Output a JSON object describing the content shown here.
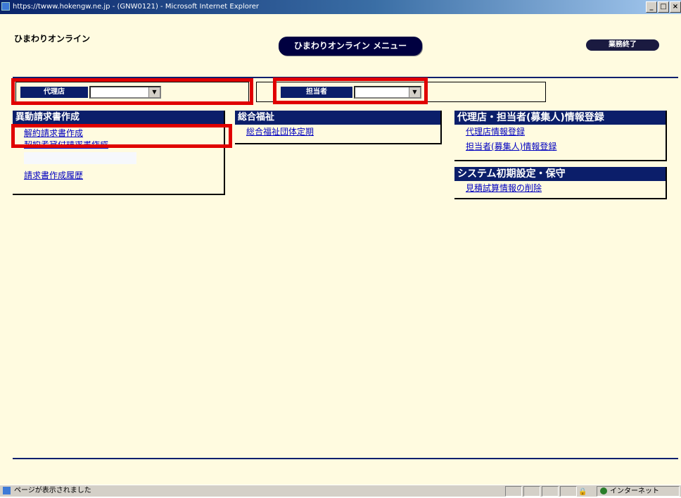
{
  "window": {
    "title": "https://twww.hokengw.ne.jp - (GNW0121) - Microsoft Internet Explorer",
    "btn_min": "_",
    "btn_max": "□",
    "btn_close": "×"
  },
  "header": {
    "app_name": "ひまわりオンライン",
    "menu_title": "ひまわりオンライン メニュー",
    "end_button": "業務終了"
  },
  "selectors": {
    "agency_label": "代理店",
    "agency_value": "",
    "staff_label": "担当者",
    "staff_value": ""
  },
  "panels": {
    "billing": {
      "title": "異動請求書作成",
      "items": [
        "解約請求書作成",
        "契約者貸付請求書作成",
        "請求書作成履歴"
      ]
    },
    "welfare": {
      "title": "総合福祉",
      "items": [
        "総合福祉団体定期"
      ]
    },
    "registration": {
      "title": "代理店・担当者(募集人)情報登録",
      "items": [
        "代理店情報登録",
        "担当者(募集人)情報登録"
      ]
    },
    "system": {
      "title": "システム初期設定・保守",
      "items": [
        "見積試算情報の削除"
      ]
    }
  },
  "status_bar": {
    "text": "ページが表示されました",
    "zone": "インターネット"
  },
  "colors": {
    "header_navy": "#0b1e6a",
    "page_bg": "#fffbe0",
    "highlight_red": "#e00000",
    "link": "#0000c0"
  }
}
